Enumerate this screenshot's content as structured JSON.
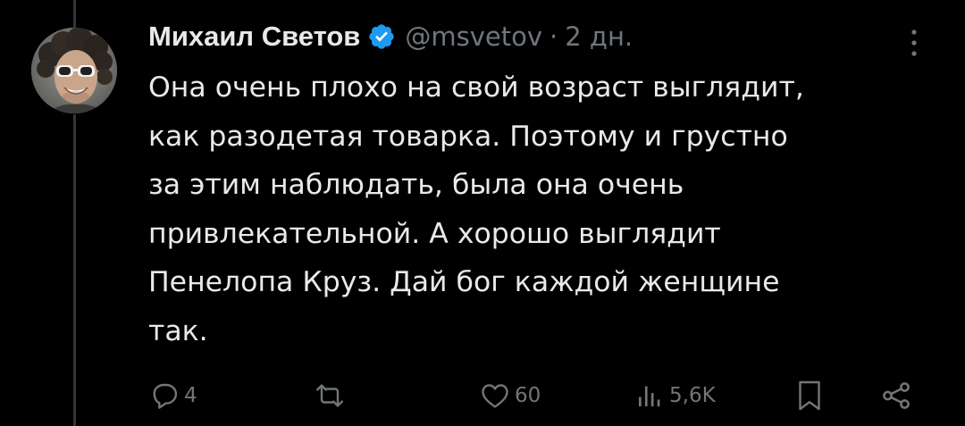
{
  "tweet": {
    "author_name": "Михаил Светов",
    "handle": "@msvetov",
    "separator": "·",
    "time": "2 дн.",
    "text_lines": [
      "Она очень плохо на свой возраст выглядит,",
      "как разодетая товарка. Поэтому и грустно",
      "за этим наблюдать, была она очень",
      "привлекательной. А хорошо выглядит",
      "Пенелопа Круз. Дай бог каждой женщине",
      "так."
    ]
  },
  "actions": {
    "reply_count": "4",
    "retweet_count": "",
    "like_count": "60",
    "views_count": "5,6K"
  },
  "icons": {
    "verified": "verified-badge-icon",
    "more": "more-vertical-icon",
    "reply": "reply-icon",
    "retweet": "retweet-icon",
    "like": "heart-icon",
    "views": "views-icon",
    "bookmark": "bookmark-icon",
    "share": "share-icon"
  },
  "colors": {
    "background": "#000000",
    "text": "#e7e9ea",
    "muted": "#71767b",
    "verified": "#1d9bf0"
  }
}
